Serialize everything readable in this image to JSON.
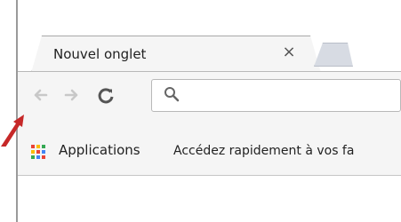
{
  "window": {
    "tab_title": "Nouvel onglet",
    "close_glyph": "×"
  },
  "toolbar": {
    "back_icon": "back-arrow-icon",
    "forward_icon": "forward-arrow-icon",
    "reload_icon": "reload-icon",
    "search_icon": "search-icon"
  },
  "bookmarks": {
    "apps_label": "Applications",
    "hint": "Accédez rapidement à vos fa"
  },
  "colors": {
    "tab_bg": "#f5f5f5",
    "toolbar_bg": "#f5f5f5",
    "new_tab": "#d7dbe3",
    "annotation_arrow": "#c62828"
  }
}
